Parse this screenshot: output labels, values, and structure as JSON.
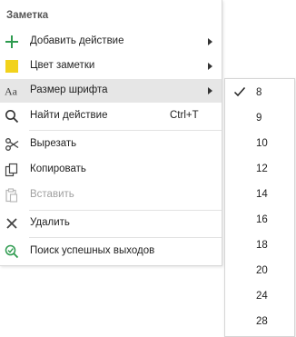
{
  "menu": {
    "title": "Заметка",
    "items": [
      {
        "label": "Добавить действие",
        "icon": "plus-icon",
        "submenu": true
      },
      {
        "label": "Цвет заметки",
        "icon": "color-square-icon",
        "submenu": true
      },
      {
        "label": "Размер шрифта",
        "icon": "font-size-icon",
        "submenu": true,
        "highlighted": true
      },
      {
        "label": "Найти действие",
        "icon": "search-icon",
        "shortcut": "Ctrl+T"
      },
      {
        "label": "Вырезать",
        "icon": "scissors-icon"
      },
      {
        "label": "Копировать",
        "icon": "copy-icon"
      },
      {
        "label": "Вставить",
        "icon": "paste-icon",
        "disabled": true
      },
      {
        "label": "Удалить",
        "icon": "close-icon"
      },
      {
        "label": "Поиск успешных выходов",
        "icon": "check-search-icon"
      }
    ]
  },
  "font_size_submenu": {
    "options": [
      "8",
      "10",
      "12",
      "14",
      "16",
      "18",
      "20",
      "24",
      "28"
    ],
    "options_all": [
      "8",
      "9",
      "10",
      "12",
      "14",
      "16",
      "18",
      "20",
      "24",
      "28"
    ],
    "selected": "8"
  },
  "colors": {
    "plus": "#2e9b4f",
    "note_color": "#f2d21b",
    "highlight": "#e6e6e6",
    "disabled": "#a0a0a0",
    "search_ok": "#2e9b4f"
  }
}
